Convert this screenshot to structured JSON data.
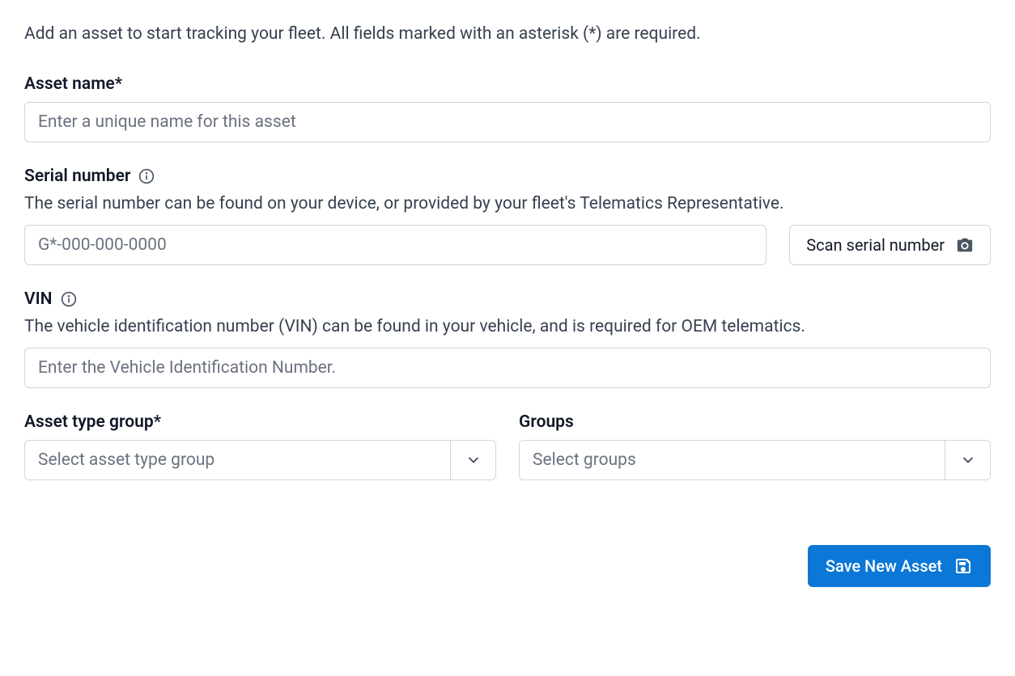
{
  "intro": "Add an asset to start tracking your fleet. All fields marked with an asterisk (*) are required.",
  "asset_name": {
    "label": "Asset name*",
    "placeholder": "Enter a unique name for this asset",
    "value": ""
  },
  "serial_number": {
    "label": "Serial number",
    "help": "The serial number can be found on your device, or provided by your fleet's Telematics Representative.",
    "placeholder": "G*-000-000-0000",
    "value": "",
    "scan_button_label": "Scan serial number"
  },
  "vin": {
    "label": "VIN",
    "help": "The vehicle identification number (VIN) can be found in your vehicle, and is required for OEM telematics.",
    "placeholder": "Enter the Vehicle Identification Number.",
    "value": ""
  },
  "asset_type_group": {
    "label": "Asset type group*",
    "placeholder": "Select asset type group"
  },
  "groups": {
    "label": "Groups",
    "placeholder": "Select groups"
  },
  "save_button_label": "Save New Asset",
  "colors": {
    "primary": "#0b77d6"
  }
}
